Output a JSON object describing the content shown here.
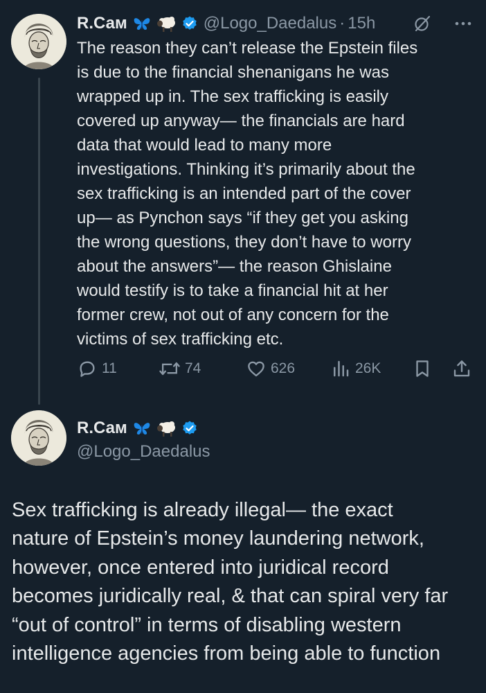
{
  "tweet1": {
    "author_name": "R.Сам",
    "handle": "@Logo_Daedalus",
    "separator": "·",
    "time": "15h",
    "body": "The reason they can’t release the Epstein files\nis due to the financial shenanigans he was\nwrapped up in. The sex trafficking is easily\ncovered up anyway— the financials are hard\ndata that would lead to many more\ninvestigations. Thinking it’s primarily about the\nsex trafficking is an intended part of the cover\nup— as Pynchon says “if they get you asking\nthe wrong questions, they don’t have to worry\nabout the answers”— the reason Ghislaine\nwould testify is to take a financial hit at her\nformer crew, not out of any concern for the\nvictims of sex trafficking etc.",
    "actions": {
      "replies": "11",
      "reposts": "74",
      "likes": "626",
      "views": "26K"
    }
  },
  "tweet2": {
    "author_name": "R.Сам",
    "handle": "@Logo_Daedalus",
    "body": "Sex trafficking is already illegal— the exact\nnature of Epstein’s money laundering network,\nhowever, once entered into juridical record\nbecomes juridically real, & that can spiral very far\n“out of control” in terms of disabling western\nintelligence agencies from being able to function"
  },
  "icons": {
    "emoji_1": "butterfly-icon",
    "emoji_2": "sheep-icon",
    "verified": "verified-badge-icon",
    "grok": "grok-icon",
    "more": "more-icon",
    "reply": "reply-icon",
    "repost": "repost-icon",
    "like": "like-icon",
    "views": "views-icon",
    "bookmark": "bookmark-icon",
    "share": "share-icon"
  },
  "colors": {
    "background": "#15202b",
    "text": "#e7e9ea",
    "secondary": "#8b98a5",
    "verified": "#1d9bf0",
    "thread_line": "#38444d"
  }
}
